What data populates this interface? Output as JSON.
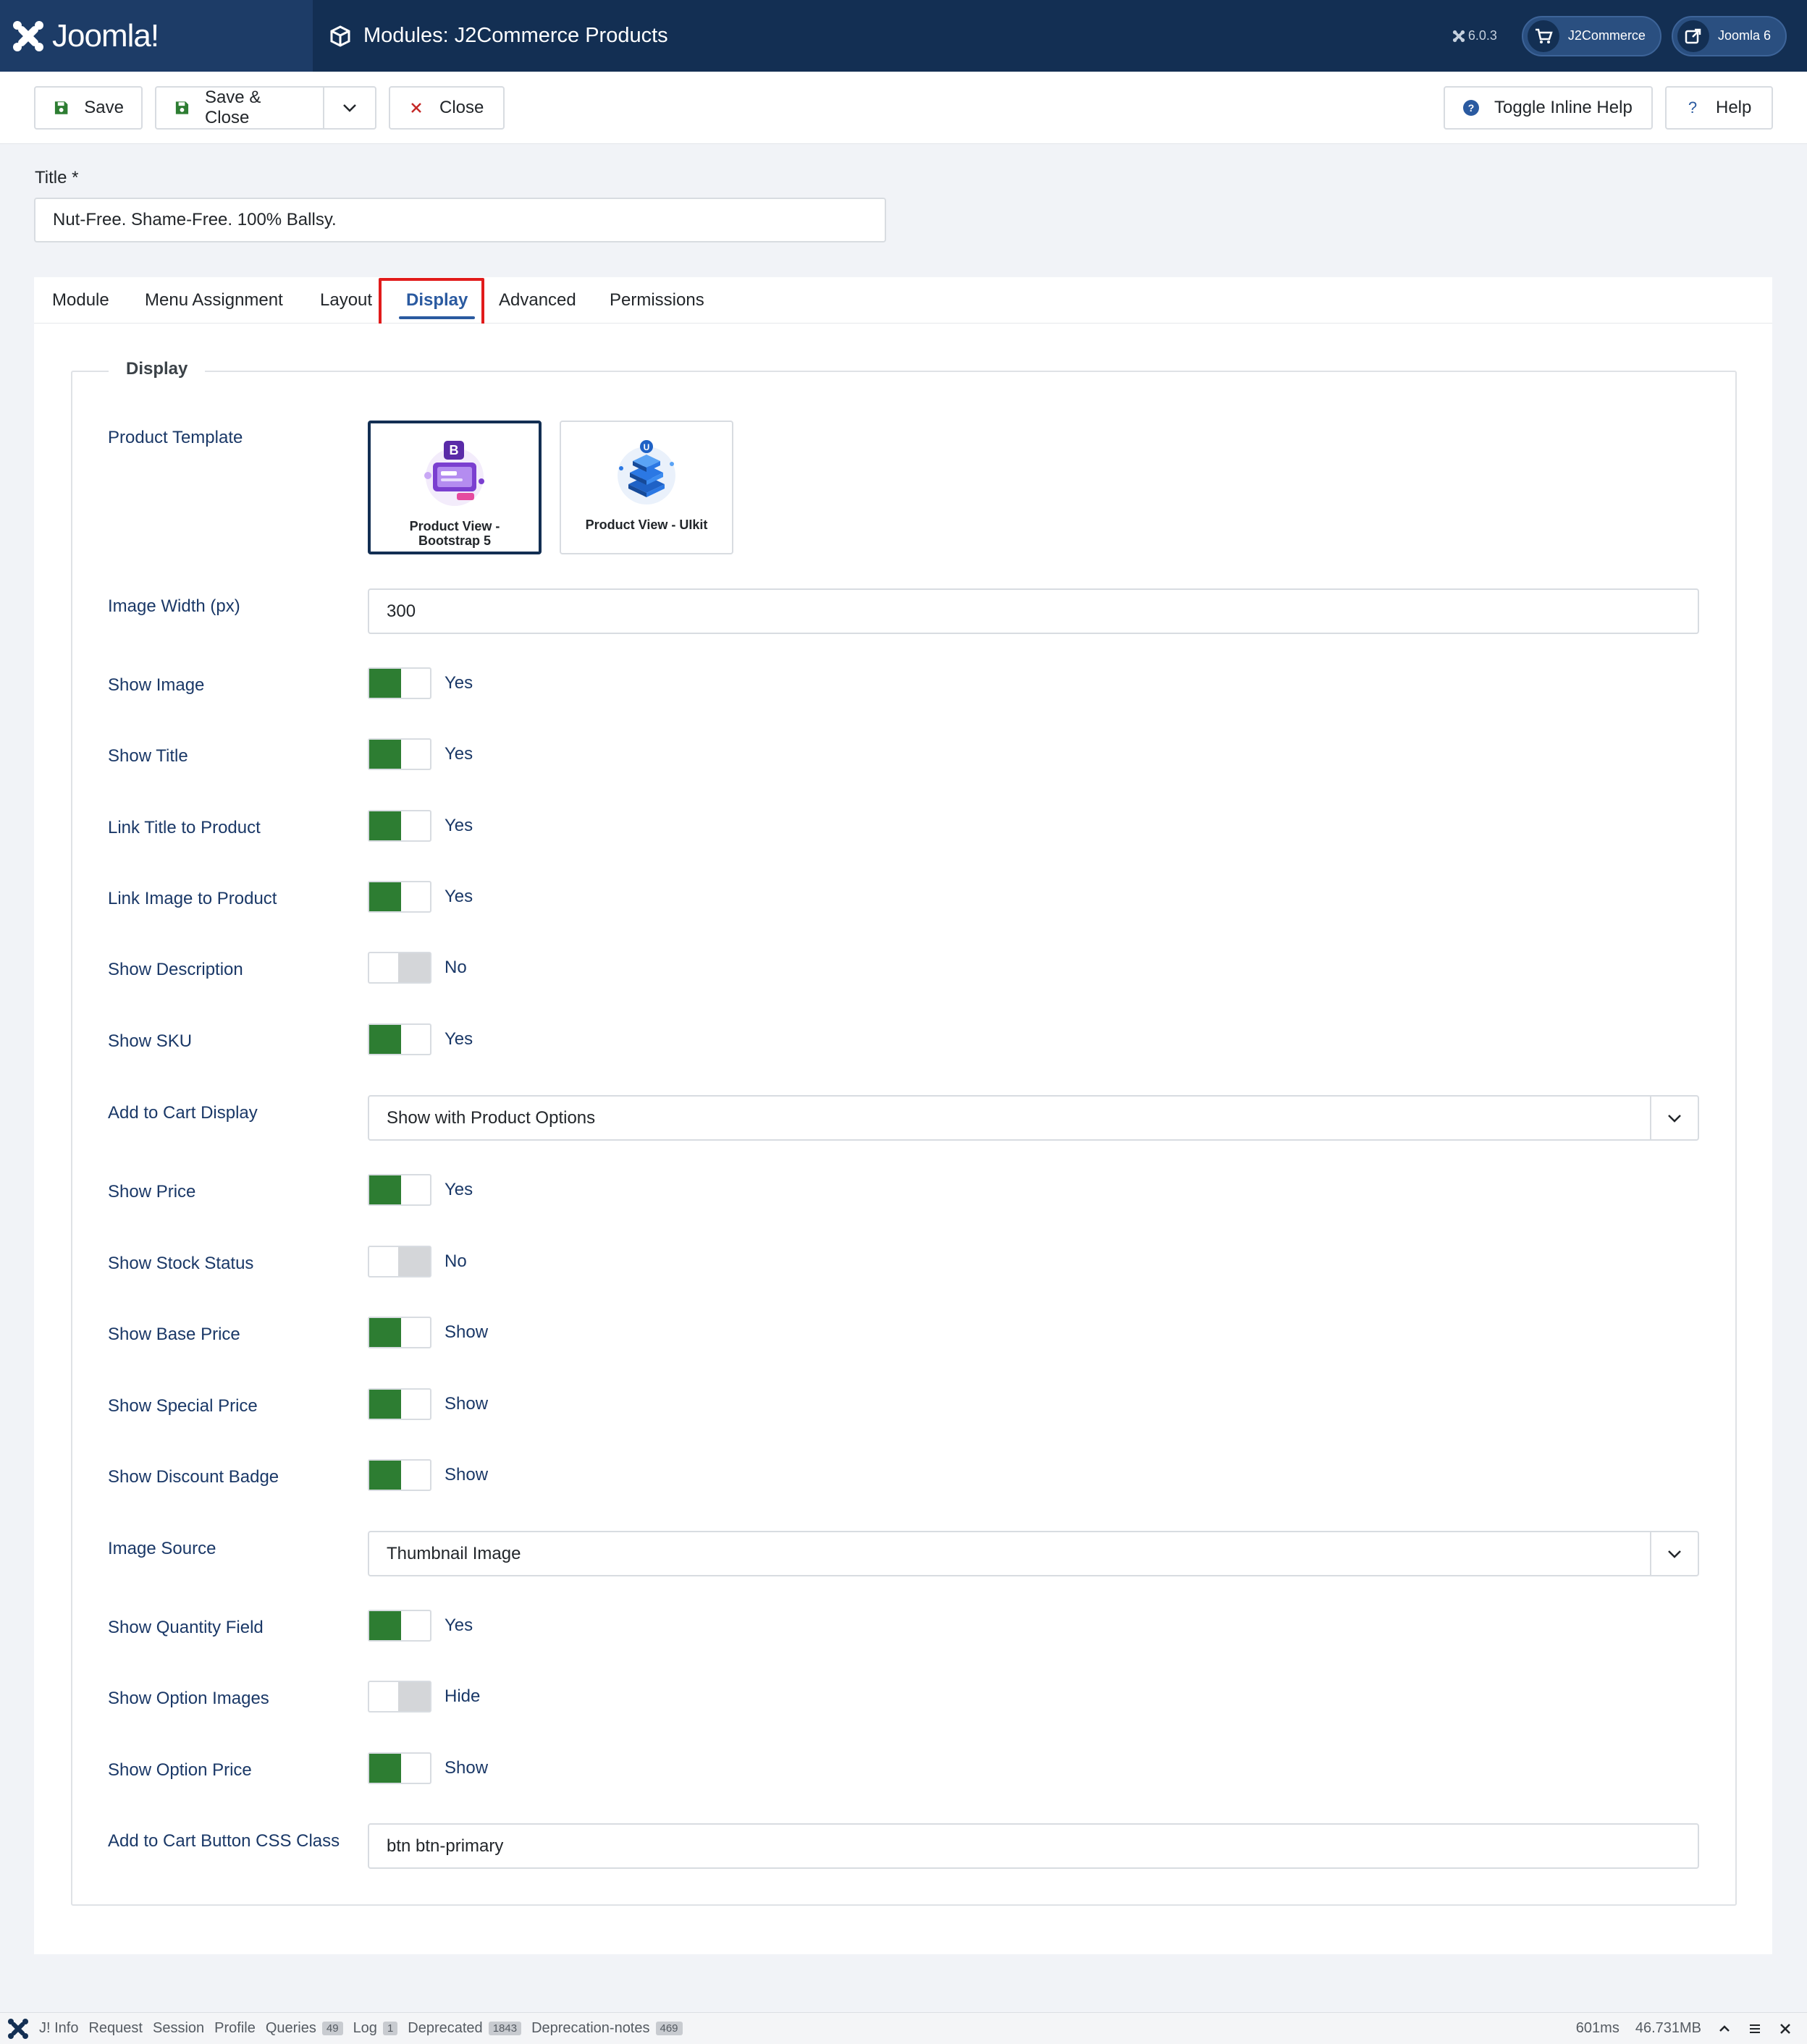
{
  "header": {
    "brand": "Joomla!",
    "title": "Modules: J2Commerce Products",
    "version": "6.0.3",
    "pills": [
      {
        "label": "J2Commerce",
        "icon": "cart-icon"
      },
      {
        "label": "Joomla 6",
        "icon": "external-link-icon"
      }
    ]
  },
  "toolbar": {
    "save": "Save",
    "save_close": "Save & Close",
    "close": "Close",
    "toggle_help": "Toggle Inline Help",
    "help": "Help"
  },
  "title_field": {
    "label": "Title *",
    "value": "Nut-Free. Shame-Free. 100% Ballsy."
  },
  "tabs": [
    "Module",
    "Menu Assignment",
    "Layout",
    "Display",
    "Advanced",
    "Permissions"
  ],
  "active_tab": "Display",
  "fieldset": {
    "legend": "Display",
    "product_template": {
      "label": "Product Template",
      "options": [
        "Product View - Bootstrap 5",
        "Product View - UIkit"
      ],
      "selected": "Product View - Bootstrap 5"
    },
    "image_width": {
      "label": "Image Width (px)",
      "value": "300"
    },
    "show_image": {
      "label": "Show Image",
      "on": true,
      "text": "Yes"
    },
    "show_title": {
      "label": "Show Title",
      "on": true,
      "text": "Yes"
    },
    "link_title": {
      "label": "Link Title to Product",
      "on": true,
      "text": "Yes"
    },
    "link_image": {
      "label": "Link Image to Product",
      "on": true,
      "text": "Yes"
    },
    "show_description": {
      "label": "Show Description",
      "on": false,
      "text": "No"
    },
    "show_sku": {
      "label": "Show SKU",
      "on": true,
      "text": "Yes"
    },
    "add_to_cart_display": {
      "label": "Add to Cart Display",
      "value": "Show with Product Options"
    },
    "show_price": {
      "label": "Show Price",
      "on": true,
      "text": "Yes"
    },
    "show_stock": {
      "label": "Show Stock Status",
      "on": false,
      "text": "No"
    },
    "show_base_price": {
      "label": "Show Base Price",
      "on": true,
      "text": "Show"
    },
    "show_special_price": {
      "label": "Show Special Price",
      "on": true,
      "text": "Show"
    },
    "show_discount_badge": {
      "label": "Show Discount Badge",
      "on": true,
      "text": "Show"
    },
    "image_source": {
      "label": "Image Source",
      "value": "Thumbnail Image"
    },
    "show_quantity": {
      "label": "Show Quantity Field",
      "on": true,
      "text": "Yes"
    },
    "show_option_images": {
      "label": "Show Option Images",
      "on": false,
      "text": "Hide"
    },
    "show_option_price": {
      "label": "Show Option Price",
      "on": true,
      "text": "Show"
    },
    "cart_button_class": {
      "label": "Add to Cart Button CSS Class",
      "value": "btn btn-primary"
    }
  },
  "debugbar": {
    "info": "J! Info",
    "request": "Request",
    "session": "Session",
    "profile": "Profile",
    "queries": "Queries",
    "queries_count": "49",
    "log": "Log",
    "log_count": "1",
    "deprecated": "Deprecated",
    "deprecated_count": "1843",
    "deprecation_notes": "Deprecation-notes",
    "deprecation_notes_count": "469",
    "time": "601ms",
    "memory": "46.731MB"
  },
  "colors": {
    "header_bg": "#132f53",
    "brand_bg": "#1d3c67",
    "switch_on": "#2d7d32",
    "label_blue": "#1a3867",
    "highlight_red": "#e11b1b",
    "active_tab": "#2a5aa0"
  }
}
